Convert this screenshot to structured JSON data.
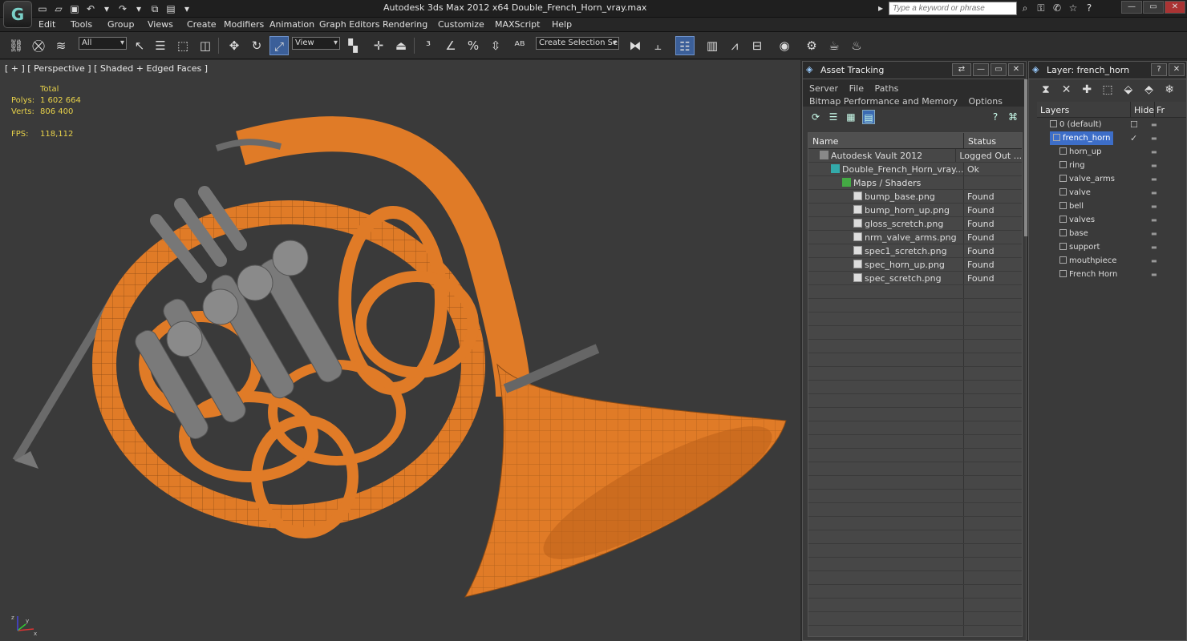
{
  "window": {
    "title": "Autodesk 3ds Max  2012 x64      Double_French_Horn_vray.max",
    "logo": "G",
    "search_placeholder": "Type a keyword or phrase"
  },
  "menu": [
    "Edit",
    "Tools",
    "Group",
    "Views",
    "Create",
    "Modifiers",
    "Animation",
    "Graph Editors",
    "Rendering",
    "Customize",
    "MAXScript",
    "Help"
  ],
  "toolbar": {
    "filter_value": "All",
    "refcoord_value": "View",
    "selection_set_value": "Create Selection Se"
  },
  "viewport": {
    "label": "[ + ] [ Perspective ] [ Shaded + Edged Faces ]",
    "stats": {
      "total_label": "Total",
      "polys_label": "Polys:",
      "polys_value": "1 602 664",
      "verts_label": "Verts:",
      "verts_value": "806 400",
      "fps_label": "FPS:",
      "fps_value": "118,112"
    },
    "axis": {
      "x": "x",
      "y": "y",
      "z": "z"
    }
  },
  "asset_tracking": {
    "title": "Asset Tracking",
    "menus_row1": [
      "Server",
      "File",
      "Paths"
    ],
    "menus_row2": [
      "Bitmap Performance and Memory",
      "Options"
    ],
    "columns": [
      "Name",
      "Status"
    ],
    "rows": [
      {
        "name": "Autodesk Vault 2012",
        "status": "Logged Out ...",
        "indent": 1,
        "icon": "vault"
      },
      {
        "name": "Double_French_Horn_vray....",
        "status": "Ok",
        "indent": 2,
        "icon": "max"
      },
      {
        "name": "Maps / Shaders",
        "status": "",
        "indent": 3,
        "icon": "maps"
      },
      {
        "name": "bump_base.png",
        "status": "Found",
        "indent": 4,
        "icon": "file"
      },
      {
        "name": "bump_horn_up.png",
        "status": "Found",
        "indent": 4,
        "icon": "file"
      },
      {
        "name": "gloss_scretch.png",
        "status": "Found",
        "indent": 4,
        "icon": "file"
      },
      {
        "name": "nrm_valve_arms.png",
        "status": "Found",
        "indent": 4,
        "icon": "file"
      },
      {
        "name": "spec1_scretch.png",
        "status": "Found",
        "indent": 4,
        "icon": "file"
      },
      {
        "name": "spec_horn_up.png",
        "status": "Found",
        "indent": 4,
        "icon": "file"
      },
      {
        "name": "spec_scretch.png",
        "status": "Found",
        "indent": 4,
        "icon": "file"
      }
    ]
  },
  "layers": {
    "title": "Layer: french_horn",
    "columns": [
      "Layers",
      "Hide",
      "Fr"
    ],
    "items": [
      {
        "name": "0 (default)",
        "level": 0,
        "selected": false,
        "check": "☐"
      },
      {
        "name": "french_horn",
        "level": 0,
        "selected": true,
        "check": "✓"
      },
      {
        "name": "horn_up",
        "level": 1,
        "selected": false,
        "check": ""
      },
      {
        "name": "ring",
        "level": 1,
        "selected": false,
        "check": ""
      },
      {
        "name": "valve_arms",
        "level": 1,
        "selected": false,
        "check": ""
      },
      {
        "name": "valve",
        "level": 1,
        "selected": false,
        "check": ""
      },
      {
        "name": "bell",
        "level": 1,
        "selected": false,
        "check": ""
      },
      {
        "name": "valves",
        "level": 1,
        "selected": false,
        "check": ""
      },
      {
        "name": "base",
        "level": 1,
        "selected": false,
        "check": ""
      },
      {
        "name": "support",
        "level": 1,
        "selected": false,
        "check": ""
      },
      {
        "name": "mouthpiece",
        "level": 1,
        "selected": false,
        "check": ""
      },
      {
        "name": "French Horn",
        "level": 1,
        "selected": false,
        "check": ""
      }
    ]
  },
  "colors": {
    "horn_orange": "#e07b27",
    "metal_gray": "#7a7a7a",
    "selection_blue": "#3d6ec8",
    "stats_yellow": "#e8d24a"
  }
}
